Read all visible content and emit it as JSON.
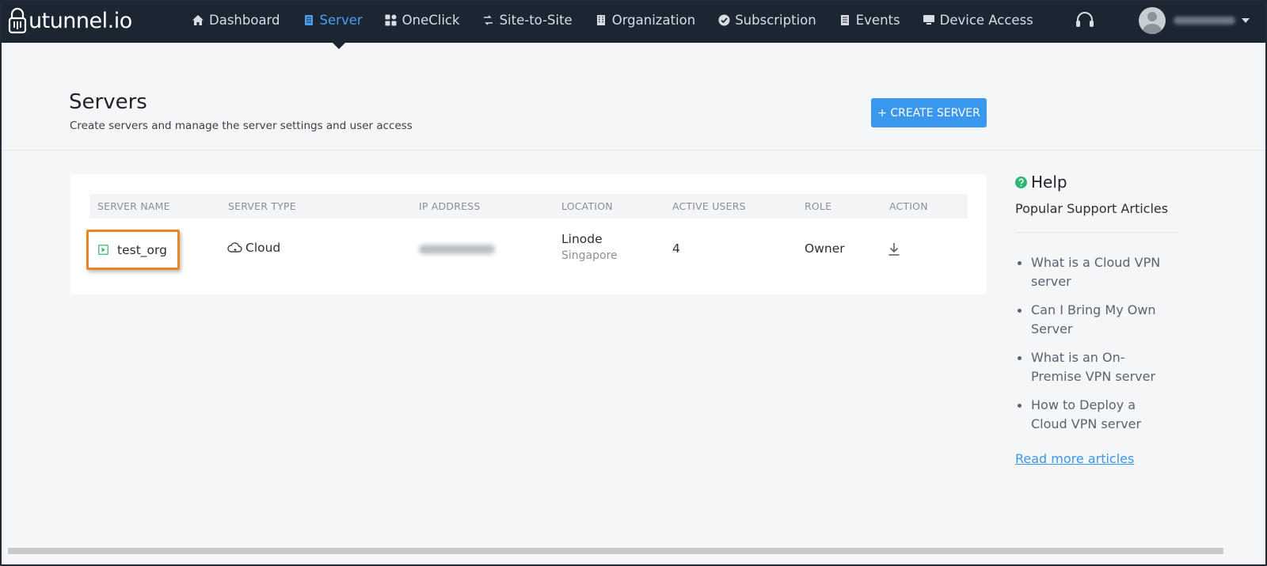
{
  "brand": {
    "name": "utunnel.io"
  },
  "nav": {
    "items": [
      {
        "label": "Dashboard",
        "icon": "home-icon",
        "active": false
      },
      {
        "label": "Server",
        "icon": "server-icon",
        "active": true
      },
      {
        "label": "OneClick",
        "icon": "grid-icon",
        "active": false
      },
      {
        "label": "Site-to-Site",
        "icon": "arrows-icon",
        "active": false
      },
      {
        "label": "Organization",
        "icon": "building-icon",
        "active": false
      },
      {
        "label": "Subscription",
        "icon": "check-circle-icon",
        "active": false
      },
      {
        "label": "Events",
        "icon": "document-icon",
        "active": false
      },
      {
        "label": "Device Access",
        "icon": "monitor-icon",
        "active": false
      }
    ]
  },
  "header": {
    "title": "Servers",
    "subtitle": "Create servers and manage the server settings and user access",
    "create_label": "+ CREATE SERVER"
  },
  "table": {
    "columns": [
      "SERVER NAME",
      "SERVER TYPE",
      "IP ADDRESS",
      "LOCATION",
      "ACTIVE USERS",
      "ROLE",
      "ACTION"
    ],
    "rows": [
      {
        "server_name": "test_org",
        "server_type": "Cloud",
        "ip_address": "",
        "location": "Linode",
        "location_sub": "Singapore",
        "active_users": "4",
        "role": "Owner",
        "action_icon": "download-icon"
      }
    ]
  },
  "help": {
    "title": "Help",
    "subtitle": "Popular Support Articles",
    "articles": [
      "What is a Cloud VPN server",
      "Can I Bring My Own Server",
      "What is an On-Premise VPN server",
      "How to Deploy a Cloud VPN server"
    ],
    "more_label": "Read more articles"
  },
  "colors": {
    "nav_bg": "#1b2632",
    "accent": "#3a97ee",
    "highlight": "#e38a25",
    "help_icon": "#2bb673"
  }
}
